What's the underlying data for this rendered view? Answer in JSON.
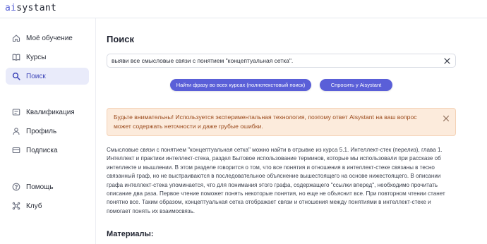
{
  "app": {
    "logo_accent": "ai",
    "logo_rest": "systant",
    "accent_color": "#5a5fd8"
  },
  "sidebar": {
    "items": [
      {
        "label": "Моё обучение",
        "icon": "home-icon"
      },
      {
        "label": "Курсы",
        "icon": "book-icon"
      },
      {
        "label": "Поиск",
        "icon": "search-icon",
        "active": true
      },
      {
        "label": "Квалификация",
        "icon": "qualification-icon"
      },
      {
        "label": "Профиль",
        "icon": "user-icon"
      },
      {
        "label": "Подписка",
        "icon": "card-icon"
      },
      {
        "label": "Помощь",
        "icon": "help-icon"
      },
      {
        "label": "Клуб",
        "icon": "club-icon"
      }
    ]
  },
  "main": {
    "title": "Поиск",
    "search": {
      "value": "выяви все смысловые связи с понятием \"концептуальная сетка\"."
    },
    "buttons": {
      "fulltext": "Найти фразу во всех курсах (полнотекстовый поиск)",
      "ask": "Спросить у Aisystant"
    },
    "alert": "Будьте внимательны! Используется экспериментальная технология, поэтому ответ Aisystant на ваш вопрос может содержать неточности и даже грубые ошибки.",
    "answer": "Смысловые связи с понятием \"концептуальная сетка\" можно найти в отрывке из курса 5.1. Интеллект-стек (перелиз), глава 1. Интеллект и практики интеллект-стека, раздел Бытовое использование терминов, которые мы использовали при рассказе об интеллекте и мышлении. В этом разделе говорится о том, что все понятия и отношения в интеллект-стеке связаны в тесно связанный граф, но не выстраиваются в последовательное объяснение вышестоящего на основе нижестоящего. В описании графа интеллект-стека упоминается, что для понимания этого графа, содержащего \"ссылки вперед\", необходимо прочитать описание два раза. Первое чтение поможет понять некоторые понятия, но еще не объяснит все. При повторном чтении станет понятно все. Таким образом, концептуальная сетка отображает связи и отношения между понятиями в интеллект-стеке и помогает понять их взаимосвязь.",
    "materials_heading": "Материалы:"
  }
}
